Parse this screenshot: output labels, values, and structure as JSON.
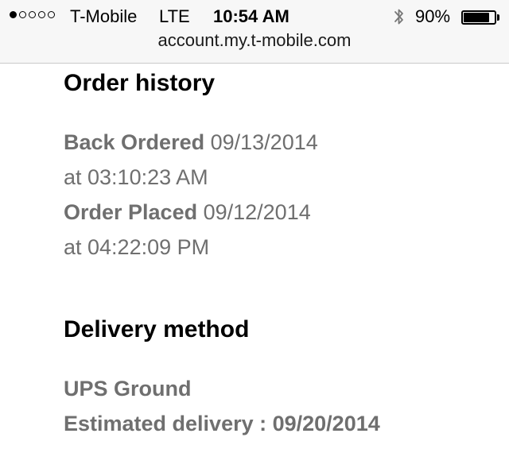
{
  "status_bar": {
    "signal_bars_filled": 1,
    "signal_bars_total": 5,
    "carrier": "T-Mobile",
    "network": "LTE",
    "time": "10:54 AM",
    "bluetooth_icon": "bluetooth-icon",
    "battery_percent": "90%",
    "battery_level": 0.9
  },
  "browser": {
    "url": "account.my.t-mobile.com"
  },
  "order_history": {
    "title": "Order history",
    "entries": [
      {
        "status": "Back Ordered",
        "date": "09/13/2014",
        "time": "at 03:10:23 AM"
      },
      {
        "status": "Order Placed",
        "date": "09/12/2014",
        "time": "at 04:22:09 PM"
      }
    ]
  },
  "delivery": {
    "title": "Delivery method",
    "method": "UPS Ground",
    "estimated": "Estimated delivery : 09/20/2014"
  }
}
